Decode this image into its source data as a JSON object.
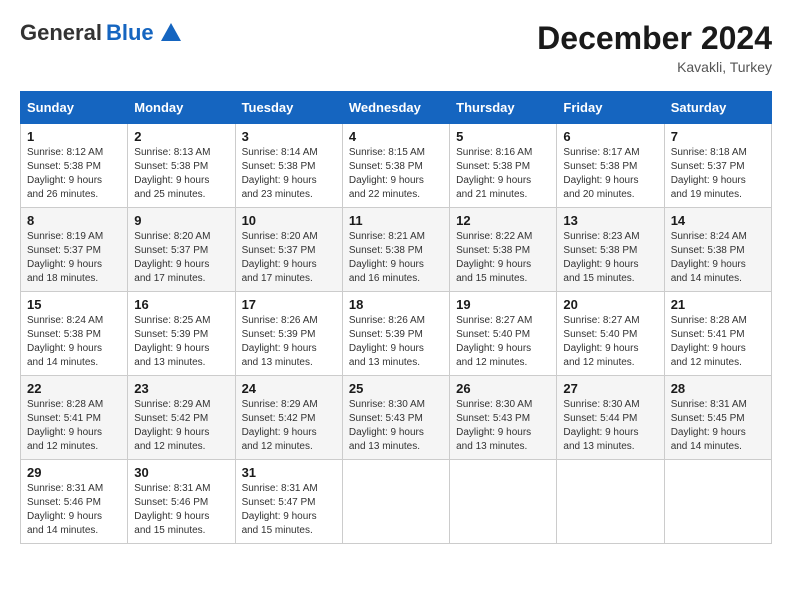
{
  "header": {
    "logo_general": "General",
    "logo_blue": "Blue",
    "month_title": "December 2024",
    "location": "Kavakli, Turkey"
  },
  "weekdays": [
    "Sunday",
    "Monday",
    "Tuesday",
    "Wednesday",
    "Thursday",
    "Friday",
    "Saturday"
  ],
  "weeks": [
    [
      {
        "day": "1",
        "sunrise": "8:12 AM",
        "sunset": "5:38 PM",
        "daylight": "9 hours and 26 minutes."
      },
      {
        "day": "2",
        "sunrise": "8:13 AM",
        "sunset": "5:38 PM",
        "daylight": "9 hours and 25 minutes."
      },
      {
        "day": "3",
        "sunrise": "8:14 AM",
        "sunset": "5:38 PM",
        "daylight": "9 hours and 23 minutes."
      },
      {
        "day": "4",
        "sunrise": "8:15 AM",
        "sunset": "5:38 PM",
        "daylight": "9 hours and 22 minutes."
      },
      {
        "day": "5",
        "sunrise": "8:16 AM",
        "sunset": "5:38 PM",
        "daylight": "9 hours and 21 minutes."
      },
      {
        "day": "6",
        "sunrise": "8:17 AM",
        "sunset": "5:38 PM",
        "daylight": "9 hours and 20 minutes."
      },
      {
        "day": "7",
        "sunrise": "8:18 AM",
        "sunset": "5:37 PM",
        "daylight": "9 hours and 19 minutes."
      }
    ],
    [
      {
        "day": "8",
        "sunrise": "8:19 AM",
        "sunset": "5:37 PM",
        "daylight": "9 hours and 18 minutes."
      },
      {
        "day": "9",
        "sunrise": "8:20 AM",
        "sunset": "5:37 PM",
        "daylight": "9 hours and 17 minutes."
      },
      {
        "day": "10",
        "sunrise": "8:20 AM",
        "sunset": "5:37 PM",
        "daylight": "9 hours and 17 minutes."
      },
      {
        "day": "11",
        "sunrise": "8:21 AM",
        "sunset": "5:38 PM",
        "daylight": "9 hours and 16 minutes."
      },
      {
        "day": "12",
        "sunrise": "8:22 AM",
        "sunset": "5:38 PM",
        "daylight": "9 hours and 15 minutes."
      },
      {
        "day": "13",
        "sunrise": "8:23 AM",
        "sunset": "5:38 PM",
        "daylight": "9 hours and 15 minutes."
      },
      {
        "day": "14",
        "sunrise": "8:24 AM",
        "sunset": "5:38 PM",
        "daylight": "9 hours and 14 minutes."
      }
    ],
    [
      {
        "day": "15",
        "sunrise": "8:24 AM",
        "sunset": "5:38 PM",
        "daylight": "9 hours and 14 minutes."
      },
      {
        "day": "16",
        "sunrise": "8:25 AM",
        "sunset": "5:39 PM",
        "daylight": "9 hours and 13 minutes."
      },
      {
        "day": "17",
        "sunrise": "8:26 AM",
        "sunset": "5:39 PM",
        "daylight": "9 hours and 13 minutes."
      },
      {
        "day": "18",
        "sunrise": "8:26 AM",
        "sunset": "5:39 PM",
        "daylight": "9 hours and 13 minutes."
      },
      {
        "day": "19",
        "sunrise": "8:27 AM",
        "sunset": "5:40 PM",
        "daylight": "9 hours and 12 minutes."
      },
      {
        "day": "20",
        "sunrise": "8:27 AM",
        "sunset": "5:40 PM",
        "daylight": "9 hours and 12 minutes."
      },
      {
        "day": "21",
        "sunrise": "8:28 AM",
        "sunset": "5:41 PM",
        "daylight": "9 hours and 12 minutes."
      }
    ],
    [
      {
        "day": "22",
        "sunrise": "8:28 AM",
        "sunset": "5:41 PM",
        "daylight": "9 hours and 12 minutes."
      },
      {
        "day": "23",
        "sunrise": "8:29 AM",
        "sunset": "5:42 PM",
        "daylight": "9 hours and 12 minutes."
      },
      {
        "day": "24",
        "sunrise": "8:29 AM",
        "sunset": "5:42 PM",
        "daylight": "9 hours and 12 minutes."
      },
      {
        "day": "25",
        "sunrise": "8:30 AM",
        "sunset": "5:43 PM",
        "daylight": "9 hours and 13 minutes."
      },
      {
        "day": "26",
        "sunrise": "8:30 AM",
        "sunset": "5:43 PM",
        "daylight": "9 hours and 13 minutes."
      },
      {
        "day": "27",
        "sunrise": "8:30 AM",
        "sunset": "5:44 PM",
        "daylight": "9 hours and 13 minutes."
      },
      {
        "day": "28",
        "sunrise": "8:31 AM",
        "sunset": "5:45 PM",
        "daylight": "9 hours and 14 minutes."
      }
    ],
    [
      {
        "day": "29",
        "sunrise": "8:31 AM",
        "sunset": "5:46 PM",
        "daylight": "9 hours and 14 minutes."
      },
      {
        "day": "30",
        "sunrise": "8:31 AM",
        "sunset": "5:46 PM",
        "daylight": "9 hours and 15 minutes."
      },
      {
        "day": "31",
        "sunrise": "8:31 AM",
        "sunset": "5:47 PM",
        "daylight": "9 hours and 15 minutes."
      },
      null,
      null,
      null,
      null
    ]
  ],
  "labels": {
    "sunrise": "Sunrise:",
    "sunset": "Sunset:",
    "daylight": "Daylight:"
  }
}
